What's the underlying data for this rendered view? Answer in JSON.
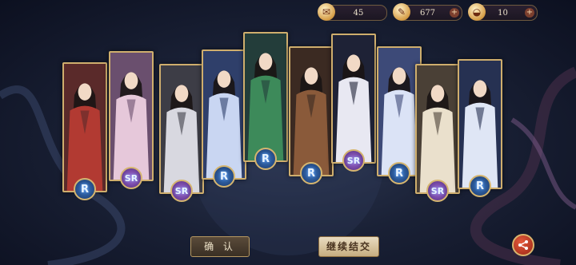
{
  "resources": [
    {
      "name": "scroll",
      "icon": "scroll-icon",
      "glyph": "✉",
      "value": "45"
    },
    {
      "name": "feather",
      "icon": "feather-icon",
      "glyph": "✎",
      "value": "677"
    },
    {
      "name": "ingot",
      "icon": "ingot-icon",
      "glyph": "◒",
      "value": "10"
    }
  ],
  "plus_symbol": "+",
  "cards": [
    {
      "rarity": "R",
      "name": "warrior-girl-red"
    },
    {
      "rarity": "SR",
      "name": "flower-girl-pink"
    },
    {
      "rarity": "SR",
      "name": "silver-haired-man"
    },
    {
      "rarity": "R",
      "name": "girl-blue-robe"
    },
    {
      "rarity": "R",
      "name": "bare-chest-swordsman"
    },
    {
      "rarity": "R",
      "name": "brown-haired-man"
    },
    {
      "rarity": "SR",
      "name": "long-black-hair-man"
    },
    {
      "rarity": "R",
      "name": "girl-lavender-robe"
    },
    {
      "rarity": "SR",
      "name": "girl-hair-ornament"
    },
    {
      "rarity": "R",
      "name": "glasses-man"
    }
  ],
  "buttons": {
    "confirm": "确 认",
    "continue": "继续结交"
  },
  "colors": {
    "frame": "#cfae6d",
    "r_badge": "#2f66b0",
    "sr_badge": "#7b46b3",
    "share": "#c0361f"
  }
}
